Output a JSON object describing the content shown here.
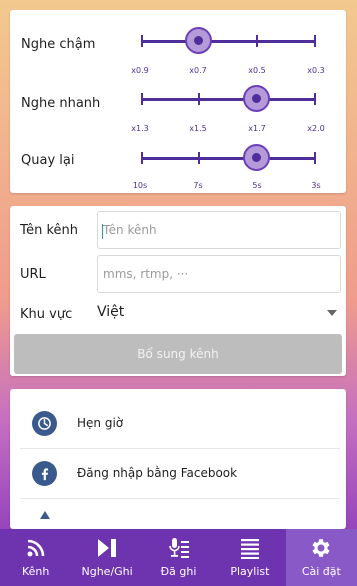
{
  "speed_settings": {
    "slow": {
      "label": "Nghe chậm",
      "ticks": [
        "x0.9",
        "x0.7",
        "x0.5",
        "x0.3"
      ],
      "selected_index": 1
    },
    "fast": {
      "label": "Nghe nhanh",
      "ticks": [
        "x1.3",
        "x1.5",
        "x1.7",
        "x2.0"
      ],
      "selected_index": 2
    },
    "rewind": {
      "label": "Quay lại",
      "ticks": [
        "10s",
        "7s",
        "5s",
        "3s"
      ],
      "selected_index": 2
    }
  },
  "add_channel": {
    "name_label": "Tên kênh",
    "name_placeholder": "Tên kênh",
    "url_label": "URL",
    "url_placeholder": "mms, rtmp, ···",
    "region_label": "Khu vực",
    "region_value": "Việt",
    "submit_label": "Bổ sung kênh"
  },
  "menu": {
    "items": [
      {
        "label": "Hẹn giờ",
        "icon": "clock-icon"
      },
      {
        "label": "Đăng nhập bằng Facebook",
        "icon": "facebook-icon"
      }
    ]
  },
  "bottom_nav": {
    "tabs": [
      {
        "label": "Kênh",
        "icon": "broadcast-icon"
      },
      {
        "label": "Nghe/Ghi",
        "icon": "play-pause-icon"
      },
      {
        "label": "Đã ghi",
        "icon": "mic-list-icon"
      },
      {
        "label": "Playlist",
        "icon": "list-icon"
      },
      {
        "label": "Cài đặt",
        "icon": "gear-icon"
      }
    ],
    "active_index": 4
  },
  "colors": {
    "accent": "#4f2d9b",
    "nav_bg": "#6e33ae",
    "nav_active": "#8a59c8",
    "menu_icon_bg": "#3a5a8e"
  }
}
